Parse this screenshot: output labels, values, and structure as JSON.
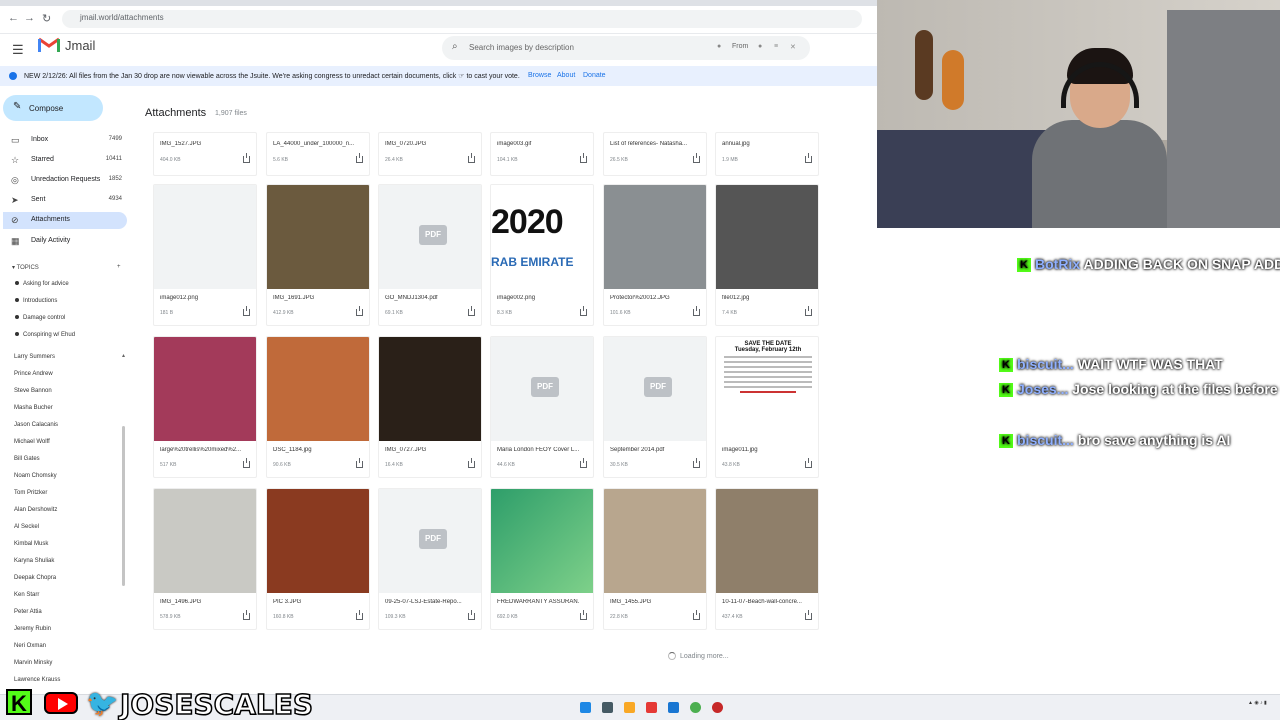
{
  "browser": {
    "url": "jmail.world/attachments"
  },
  "app": {
    "name": "Jmail"
  },
  "search": {
    "placeholder": "Search images by description",
    "from_label": "From"
  },
  "banner": {
    "text": "NEW 2/12/26: All files from the Jan 30 drop are now viewable across the Jsuite. We're asking congress to unredact certain documents, click ☞ to cast your vote.",
    "links": [
      "Browse",
      "About",
      "Donate"
    ]
  },
  "sidebar": {
    "compose": "Compose",
    "items": [
      {
        "label": "Inbox",
        "count": "7499",
        "icon": "inbox-icon"
      },
      {
        "label": "Starred",
        "count": "10411",
        "icon": "star-icon"
      },
      {
        "label": "Unredaction Requests",
        "count": "1852",
        "icon": "eye-off-icon"
      },
      {
        "label": "Sent",
        "count": "4934",
        "icon": "send-icon"
      },
      {
        "label": "Attachments",
        "count": "",
        "icon": "paperclip-icon"
      },
      {
        "label": "Daily Activity",
        "count": "",
        "icon": "calendar-icon"
      }
    ],
    "topics_label": "TOPICS",
    "topics": [
      "Asking for advice",
      "Introductions",
      "Damage control",
      "Conspiring w/ Ehud"
    ],
    "people": [
      "Larry Summers",
      "Prince Andrew",
      "Steve Bannon",
      "Masha Bucher",
      "Jason Calacanis",
      "Michael Wolff",
      "Bill Gates",
      "Noam Chomsky",
      "Tom Pritzker",
      "Alan Dershowitz",
      "Al Seckel",
      "Kimbal Musk",
      "Karyna Shuliak",
      "Deepak Chopra",
      "Ken Starr",
      "Peter Attia",
      "Jeremy Rubin",
      "Neri Oxman",
      "Marvin Minsky",
      "Lawrence Krauss"
    ]
  },
  "main": {
    "title": "Attachments",
    "count": "1,907 files",
    "loading": "Loading more...",
    "row0": [
      {
        "name": "IMG_1527.JPG",
        "size": "404.0 KB"
      },
      {
        "name": "LA_44000_under_100000_n...",
        "size": "5.6 KB"
      },
      {
        "name": "IMG_0720.JPG",
        "size": "26.4 KB"
      },
      {
        "name": "image003.gif",
        "size": "104.1 KB"
      },
      {
        "name": "List of references- Natasha...",
        "size": "26.5 KB"
      },
      {
        "name": "annual.jpg",
        "size": "1.9 MB"
      }
    ],
    "row1": [
      {
        "name": "image012.png",
        "size": "181 B"
      },
      {
        "name": "IMG_1691.JPG",
        "size": "412.9 KB"
      },
      {
        "name": "GO_MNDJ1304.pdf",
        "size": "69.1 KB"
      },
      {
        "name": "image002.png",
        "size": "8.3 KB"
      },
      {
        "name": "Protector%20012.JPG",
        "size": "101.6 KB"
      },
      {
        "name": "file012.jpg",
        "size": "7.4 KB"
      }
    ],
    "row2": [
      {
        "name": "large%20trellis%20mixed%2...",
        "size": "517 KB"
      },
      {
        "name": "DSC_1184.jpg",
        "size": "90.6 KB"
      },
      {
        "name": "IMG_0727.JPG",
        "size": "16.4 KB"
      },
      {
        "name": "Maria London FEOY Cover L...",
        "size": "44.6 KB"
      },
      {
        "name": "September 2014.pdf",
        "size": "30.5 KB"
      },
      {
        "name": "image011.jpg",
        "size": "43.8 KB"
      }
    ],
    "row3": [
      {
        "name": "IMG_1496.JPG",
        "size": "578.9 KB"
      },
      {
        "name": "PIC 3.JPG",
        "size": "160.8 KB"
      },
      {
        "name": "09-25-07-LSJ-Estate-Repo...",
        "size": "109.3 KB"
      },
      {
        "name": "FREDWARRANTY ASSURAN...",
        "size": "692.0 KB"
      },
      {
        "name": "IMG_1455.JPG",
        "size": "22.8 KB"
      },
      {
        "name": "10-11-07-Beach-wall-concre...",
        "size": "437.4 KB"
      }
    ],
    "partial_texts": {
      "year": "2020",
      "emirates": "RAB EMIRATE",
      "flyer_title": "SAVE THE DATE",
      "flyer_sub": "Tuesday, February 12th",
      "pdf": "PDF"
    }
  },
  "overlay_chat": {
    "lines": [
      {
        "user": "BotRix",
        "text": "ADDING BACK ON SNAP ADD ME BELOW"
      },
      {
        "user": "biscuit...",
        "text": "WAIT WTF WAS THAT"
      },
      {
        "user": "Joses...",
        "text": "Jose looking at the files before Grab"
      },
      {
        "user": "biscuit...",
        "text": "bro save anything is AI"
      }
    ]
  },
  "stream_branding": {
    "handle": "JOSESCALES"
  },
  "colors": {
    "accent": "#1a73e8",
    "compose": "#c2e7ff",
    "active": "#d3e3fd",
    "kick": "#53fc18"
  }
}
